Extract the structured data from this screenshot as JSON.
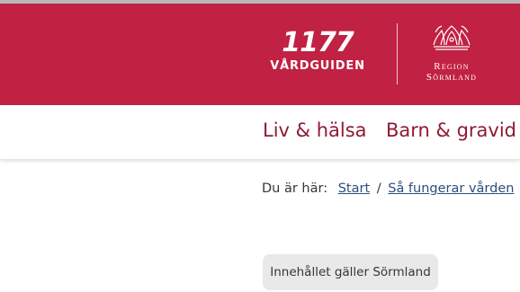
{
  "header": {
    "logo_number": "1177",
    "logo_subtitle": "VÅRDGUIDEN",
    "region_line1": "Region",
    "region_line2": "Sörmland",
    "brand_color": "#c12143"
  },
  "nav": {
    "items": [
      {
        "label": "Liv & hälsa"
      },
      {
        "label": "Barn & gravid"
      }
    ]
  },
  "breadcrumb": {
    "prefix": "Du är här:",
    "items": [
      {
        "label": "Start"
      },
      {
        "label": "Så fungerar vården"
      }
    ],
    "separator": "/"
  },
  "badge": {
    "label": "Innehållet gäller Sörmland"
  }
}
